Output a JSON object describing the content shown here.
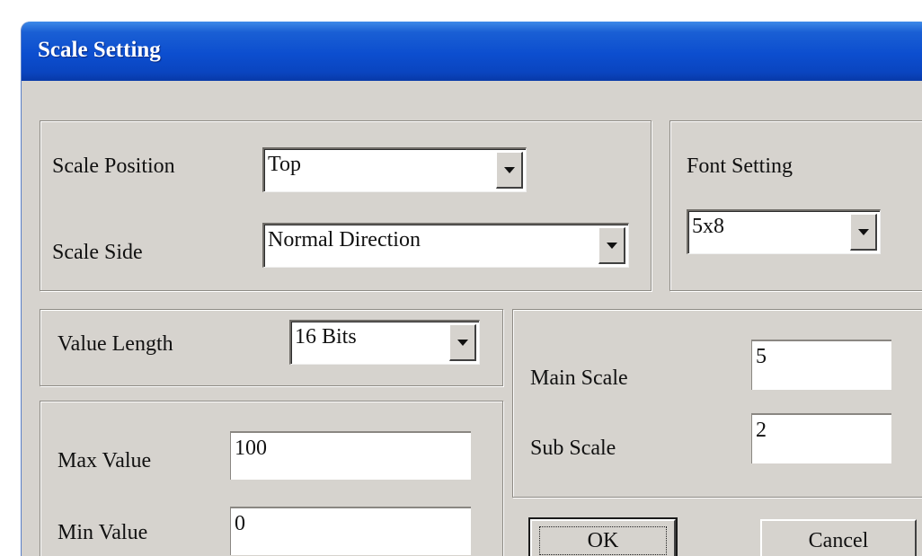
{
  "window": {
    "title": "Scale Setting",
    "titlebar_color": "#0c4ecf",
    "face_color": "#d6d3ce"
  },
  "scale_group": {
    "position_label": "Scale Position",
    "position_value": "Top",
    "side_label": "Scale Side",
    "side_value": "Normal Direction"
  },
  "font_group": {
    "label": "Font Setting",
    "value": "5x8"
  },
  "value_length_group": {
    "label": "Value Length",
    "value": "16 Bits"
  },
  "range_group": {
    "max_label": "Max Value",
    "max_value": "100",
    "min_label": "Min Value",
    "min_value": "0"
  },
  "scale_values_group": {
    "main_label": "Main Scale",
    "main_value": "5",
    "sub_label": "Sub Scale",
    "sub_value": "2"
  },
  "buttons": {
    "ok": "OK",
    "cancel": "Cancel"
  },
  "icons": {
    "dropdown": "chevron-down-icon"
  }
}
